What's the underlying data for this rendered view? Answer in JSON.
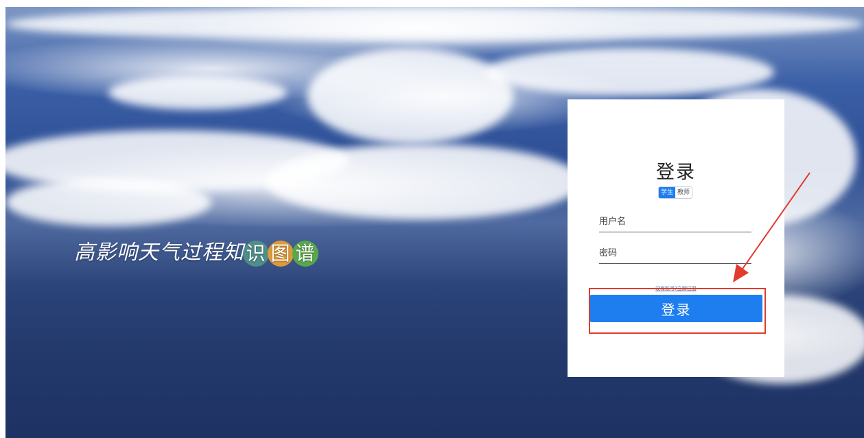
{
  "brand": {
    "title_prefix": "高影响天气过程知",
    "title_badges": [
      "识",
      "图",
      "谱"
    ]
  },
  "login": {
    "title": "登录",
    "roles": [
      {
        "label": "学生",
        "active": true
      },
      {
        "label": "教师",
        "active": false
      }
    ],
    "username_placeholder": "用户名",
    "password_placeholder": "密码",
    "register_link": "没有账号?立即注册",
    "submit_label": "登录"
  },
  "annotation": {
    "color": "#e23b2e"
  },
  "colors": {
    "primary": "#1e7ef0"
  }
}
